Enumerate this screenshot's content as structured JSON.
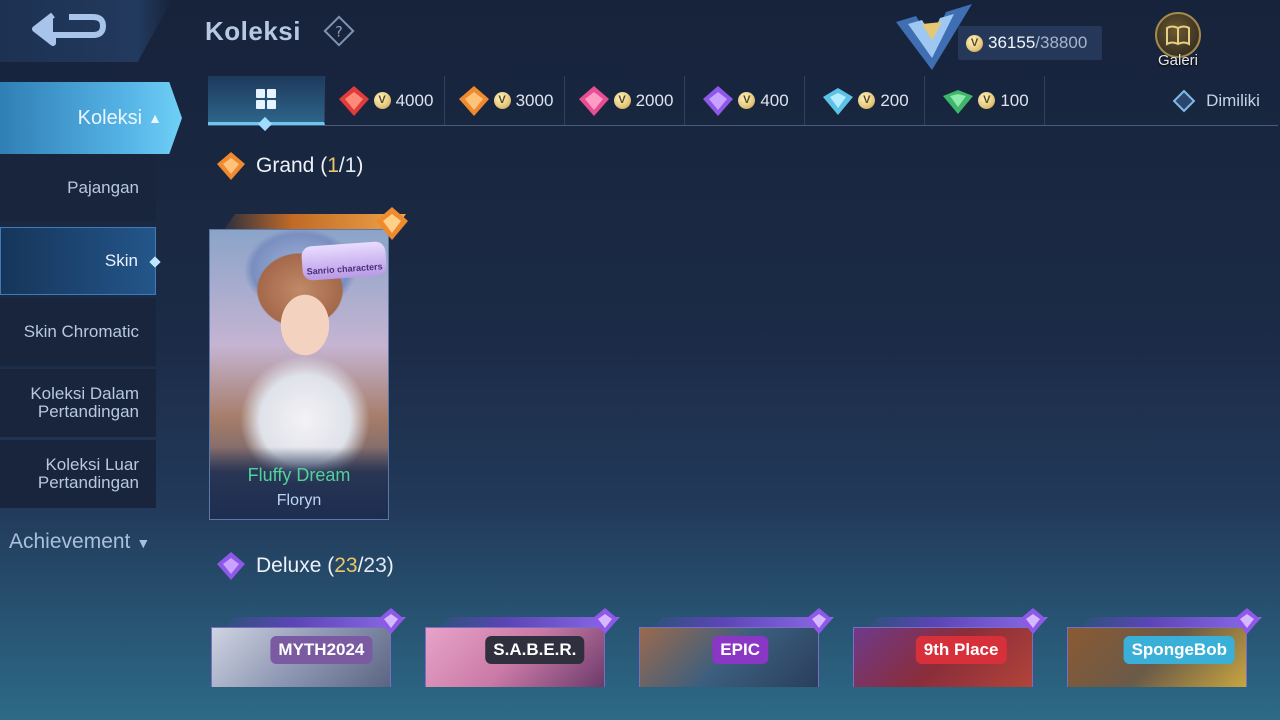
{
  "header": {
    "title": "Koleksi",
    "points_current": "36155",
    "points_separator": "/",
    "points_total": "38800",
    "gallery_label": "Galeri"
  },
  "tabs": [
    {
      "label": "4000",
      "icon": "red-gem-icon",
      "color": "#e23b3b"
    },
    {
      "label": "3000",
      "icon": "orange-gem-icon",
      "color": "#f08a2e"
    },
    {
      "label": "2000",
      "icon": "pink-gem-icon",
      "color": "#e84f93"
    },
    {
      "label": "400",
      "icon": "purple-gem-icon",
      "color": "#8e58e8"
    },
    {
      "label": "200",
      "icon": "cyan-gem-icon",
      "color": "#5cc3e6"
    },
    {
      "label": "100",
      "icon": "green-gem-icon",
      "color": "#3fb76a"
    }
  ],
  "owned_label": "Dimiliki",
  "sidebar": {
    "main": "Koleksi",
    "items": [
      "Pajangan",
      "Skin",
      "Skin Chromatic",
      "Koleksi Dalam Pertandingan",
      "Koleksi Luar Pertandingan"
    ],
    "achievement": "Achievement"
  },
  "sections": {
    "grand": {
      "name": "Grand",
      "owned": "1",
      "total": "1"
    },
    "deluxe": {
      "name": "Deluxe",
      "owned": "23",
      "total": "23"
    }
  },
  "grand_skin": {
    "skin_name": "Fluffy Dream",
    "hero_name": "Floryn",
    "logo_text": "Sanrio characters"
  },
  "deluxe_cards": [
    {
      "logo": "MYTH2024",
      "bg": "#8f98b4",
      "logo_bg": "#7a5aa0"
    },
    {
      "logo": "S.A.B.E.R.",
      "bg": "#c97aa6",
      "logo_bg": "#2f2f3e"
    },
    {
      "logo": "EPIC",
      "bg": "#3c5e7e",
      "logo_bg": "#8a37c6"
    },
    {
      "logo": "9th Place",
      "bg": "#8a2d3a",
      "logo_bg": "#d8303a"
    },
    {
      "logo": "SpongeBob",
      "bg": "#6a5a48",
      "logo_bg": "#3ab0d8"
    }
  ],
  "colors": {
    "accent": "#56b4e6",
    "grand_name": "#4fd29b",
    "count_owned": "#e9c766"
  }
}
